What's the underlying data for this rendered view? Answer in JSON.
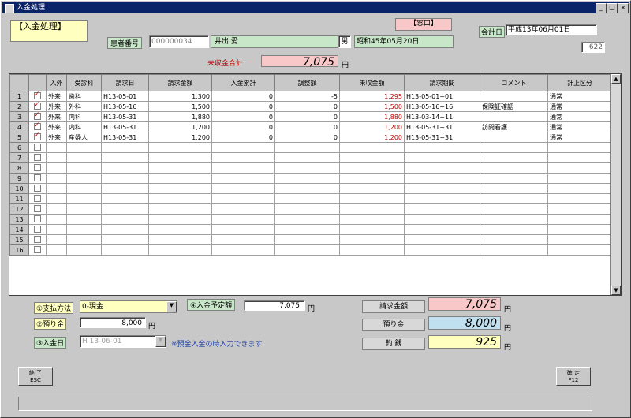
{
  "window": {
    "title": "入金処理"
  },
  "header": {
    "section_label": "【入金処理】",
    "cursor_label": "【窓口】",
    "billing_date_label": "会計日",
    "billing_date_value": "平成13年06月01日",
    "small_field_value": "622",
    "patient_no_label": "患者番号",
    "patient_no_value": "000000034",
    "patient_name_value": "井出 愛",
    "sex_value": "男",
    "birth_value": "昭和45年05月20日",
    "unpaid_total_label": "未収金合計",
    "unpaid_total_value": "7,075",
    "yen": "円"
  },
  "table": {
    "columns": [
      "",
      "入外",
      "受診科",
      "請求日",
      "請求金額",
      "入金累計",
      "調整額",
      "未収金額",
      "請求期間",
      "コメント",
      "計上区分"
    ],
    "rows": [
      {
        "no": "1",
        "checked": true,
        "io": "外来",
        "dept": "歯科",
        "date": "H13-05-01",
        "amount": "1,300",
        "paid": "0",
        "adj": "-5",
        "unpaid": "1,295",
        "period": "H13-05-01~01",
        "comment": "",
        "cat": "通常"
      },
      {
        "no": "2",
        "checked": true,
        "io": "外来",
        "dept": "外科",
        "date": "H13-05-16",
        "amount": "1,500",
        "paid": "0",
        "adj": "0",
        "unpaid": "1,500",
        "period": "H13-05-16~16",
        "comment": "保険証確認",
        "cat": "通常"
      },
      {
        "no": "3",
        "checked": true,
        "io": "外来",
        "dept": "内科",
        "date": "H13-05-31",
        "amount": "1,880",
        "paid": "0",
        "adj": "0",
        "unpaid": "1,880",
        "period": "H13-03-14~11",
        "comment": "",
        "cat": "通常"
      },
      {
        "no": "4",
        "checked": true,
        "io": "外来",
        "dept": "内科",
        "date": "H13-05-31",
        "amount": "1,200",
        "paid": "0",
        "adj": "0",
        "unpaid": "1,200",
        "period": "H13-05-31~31",
        "comment": "訪問看護",
        "cat": "通常"
      },
      {
        "no": "5",
        "checked": true,
        "io": "外来",
        "dept": "産婦人",
        "date": "H13-05-31",
        "amount": "1,200",
        "paid": "0",
        "adj": "0",
        "unpaid": "1,200",
        "period": "H13-05-31~31",
        "comment": "",
        "cat": "通常"
      },
      {
        "no": "6"
      },
      {
        "no": "7"
      },
      {
        "no": "8"
      },
      {
        "no": "9"
      },
      {
        "no": "10"
      },
      {
        "no": "11"
      },
      {
        "no": "12"
      },
      {
        "no": "13"
      },
      {
        "no": "14"
      },
      {
        "no": "15"
      },
      {
        "no": "16"
      }
    ]
  },
  "footer": {
    "payment_method_label": "①支払方法",
    "payment_method_value": "0-現金",
    "deposit_label": "②預り金",
    "deposit_value": "8,000",
    "deposit_date_label": "③入金日",
    "deposit_date_value": "H 13-06-01",
    "deposit_note": "※預金入金の時入力できます",
    "scheduled_label": "④入金予定額",
    "scheduled_value": "7,075",
    "billed_label": "請求金額",
    "billed_value": "7,075",
    "received_label": "預り金",
    "received_value": "8,000",
    "change_label": "釣 銭",
    "change_value": "925",
    "yen": "円",
    "end_button": "終 了\nESC",
    "confirm_button": "確 定\nF12"
  },
  "colors": {
    "title_bar": "#0a246a",
    "highlight_yellow": "#ffffc0",
    "green": "#c8e6c8",
    "pink": "#f8c8c8",
    "blue": "#c0e0f0",
    "red_text": "#c00000"
  }
}
